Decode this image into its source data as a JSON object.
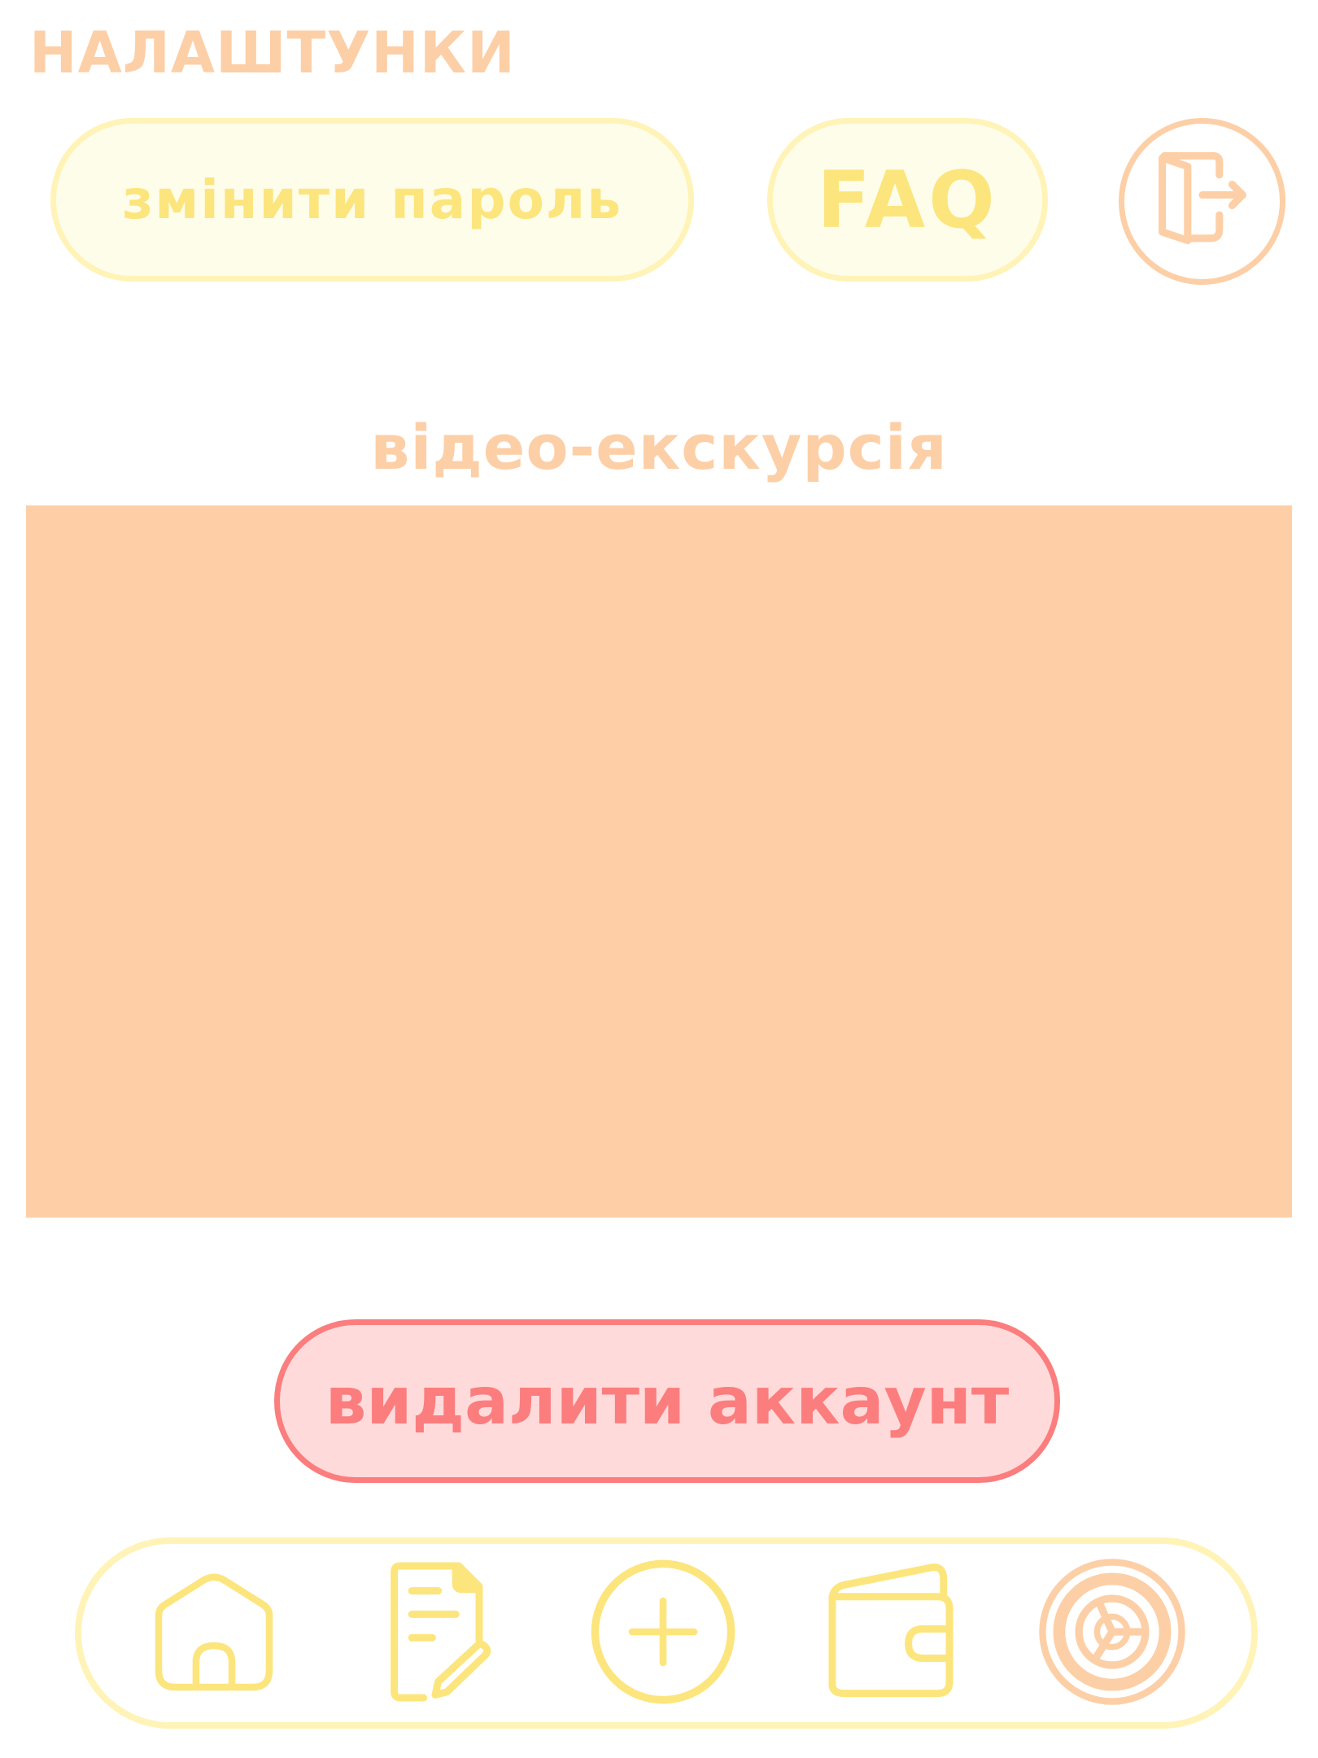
{
  "header": {
    "title": "НАЛАШТУНКИ"
  },
  "actions": {
    "change_password_label": "змінити пароль",
    "faq_label": "FAQ",
    "logout_icon": "logout-door-icon"
  },
  "video_section": {
    "title": "відео-екскурсія"
  },
  "danger": {
    "delete_account_label": "видалити аккаунт"
  },
  "bottom_nav": {
    "items": [
      {
        "icon": "home-icon",
        "active": false
      },
      {
        "icon": "notes-edit-icon",
        "active": false
      },
      {
        "icon": "add-circle-icon",
        "active": false
      },
      {
        "icon": "wallet-icon",
        "active": false
      },
      {
        "icon": "target-icon",
        "active": true
      }
    ]
  },
  "colors": {
    "peach": "#fdcfa6",
    "yellow": "#fce57c",
    "yellow_border": "#fff3b7",
    "yellow_fill": "#fefdea",
    "red": "#fb7d7d",
    "red_fill": "#ffdadb",
    "video_fill": "#fecfa7"
  }
}
